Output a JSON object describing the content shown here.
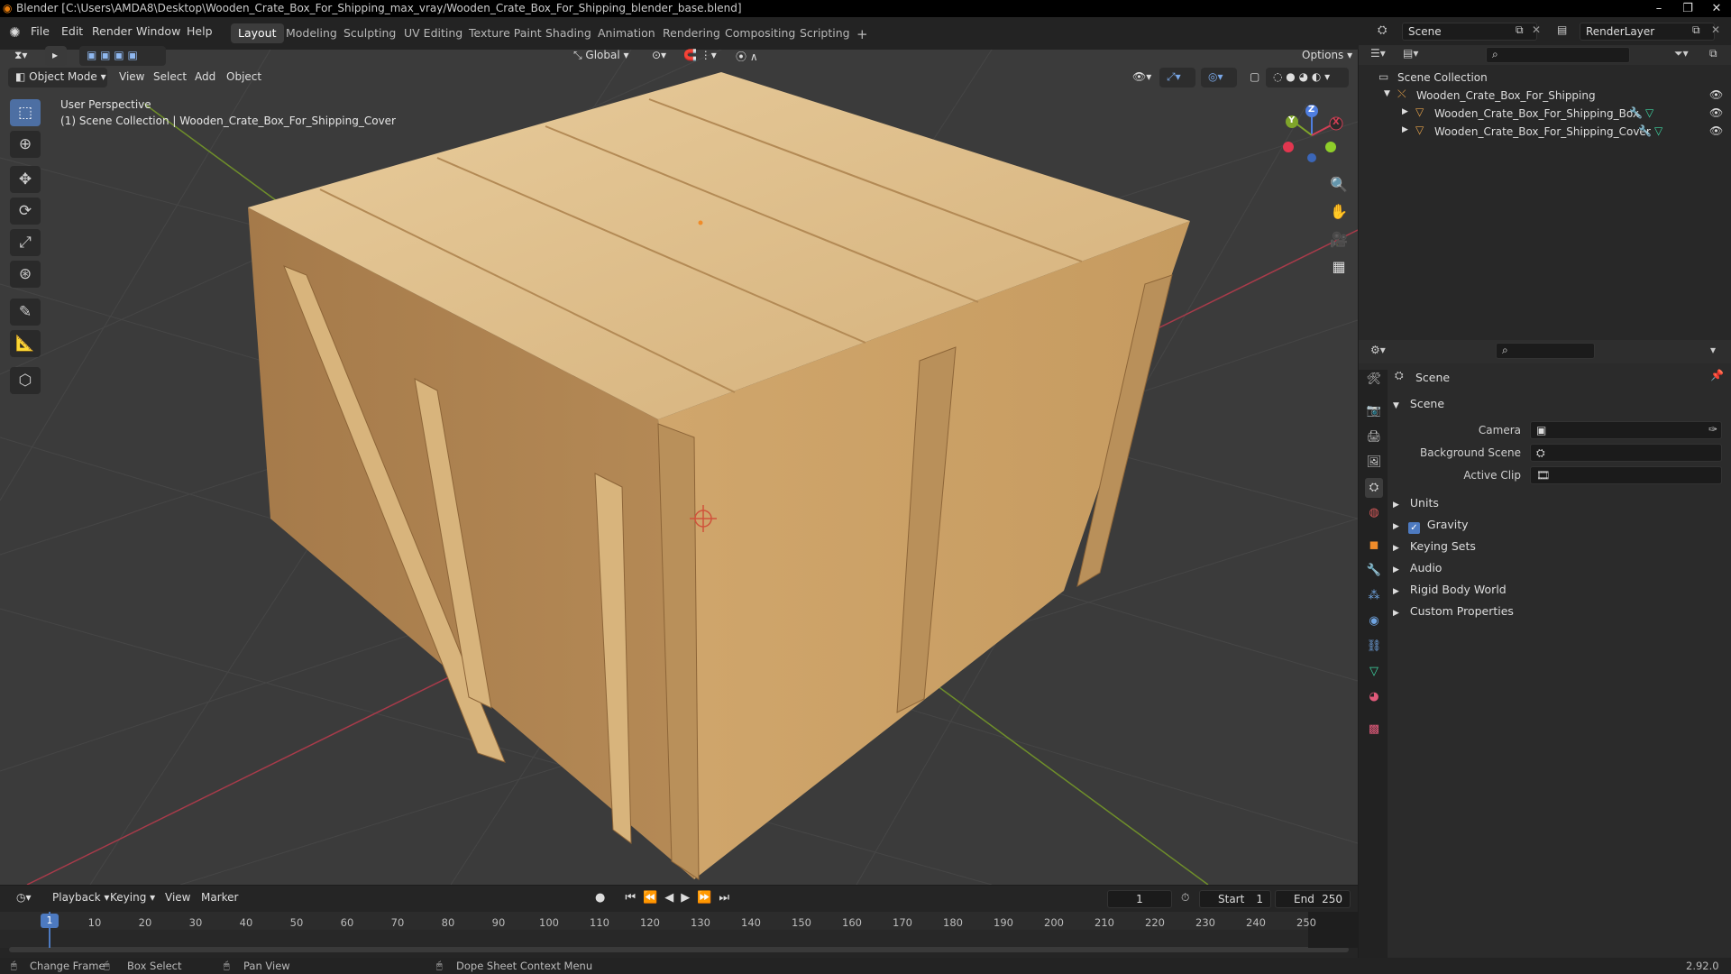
{
  "window": {
    "title": "Blender [C:\\Users\\AMDA8\\Desktop\\Wooden_Crate_Box_For_Shipping_max_vray/Wooden_Crate_Box_For_Shipping_blender_base.blend]",
    "minimize": "–",
    "maximize": "❐",
    "close": "✕"
  },
  "menubar": {
    "items": [
      "File",
      "Edit",
      "Render",
      "Window",
      "Help"
    ]
  },
  "workspaces": {
    "tabs": [
      "Layout",
      "Modeling",
      "Sculpting",
      "UV Editing",
      "Texture Paint",
      "Shading",
      "Animation",
      "Rendering",
      "Compositing",
      "Scripting"
    ],
    "active": "Layout",
    "add": "+"
  },
  "scene_selector": {
    "value": "Scene"
  },
  "renderlayer_selector": {
    "value": "RenderLayer"
  },
  "toolbar": {
    "transform_orientation": "Global",
    "options": "Options"
  },
  "viewport_header": {
    "mode": "Object Mode",
    "menus": [
      "View",
      "Select",
      "Add",
      "Object"
    ]
  },
  "viewport": {
    "perspective": "User Perspective",
    "collection_info": "(1) Scene Collection | Wooden_Crate_Box_For_Shipping_Cover",
    "gizmo": {
      "x": "X",
      "y": "Y",
      "z": "Z"
    },
    "colors": {
      "background": "#3b3b3b",
      "grid": "#4a4a4a",
      "x_axis": "#a83b4a",
      "y_axis": "#6f8f2a",
      "wood_light": "#e3c390",
      "wood_mid": "#c9a068",
      "wood_dark": "#9b7346"
    }
  },
  "outliner": {
    "root": "Scene Collection",
    "items": [
      {
        "label": "Wooden_Crate_Box_For_Shipping",
        "icon": "empty-icon"
      },
      {
        "label": "Wooden_Crate_Box_For_Shipping_Box",
        "icon": "mesh-icon"
      },
      {
        "label": "Wooden_Crate_Box_For_Shipping_Cover",
        "icon": "mesh-icon"
      }
    ]
  },
  "properties": {
    "header": "Scene",
    "section": "Scene",
    "fields": [
      {
        "label": "Camera",
        "value": ""
      },
      {
        "label": "Background Scene",
        "value": ""
      },
      {
        "label": "Active Clip",
        "value": ""
      }
    ],
    "panels": [
      "Units",
      "Gravity",
      "Keying Sets",
      "Audio",
      "Rigid Body World",
      "Custom Properties"
    ],
    "gravity_checked": true
  },
  "timeline": {
    "menus": [
      "Playback",
      "Keying",
      "View",
      "Marker"
    ],
    "current_frame": "1",
    "start_label": "Start",
    "start": "1",
    "end_label": "End",
    "end": "250",
    "ticks": [
      "10",
      "20",
      "30",
      "40",
      "50",
      "60",
      "70",
      "80",
      "90",
      "100",
      "110",
      "120",
      "130",
      "140",
      "150",
      "160",
      "170",
      "180",
      "190",
      "200",
      "210",
      "220",
      "230",
      "240",
      "250"
    ],
    "playhead": "1"
  },
  "statusbar": {
    "items": [
      "Change Frame",
      "Box Select",
      "Pan View",
      "Dope Sheet Context Menu"
    ],
    "version": "2.92.0"
  }
}
